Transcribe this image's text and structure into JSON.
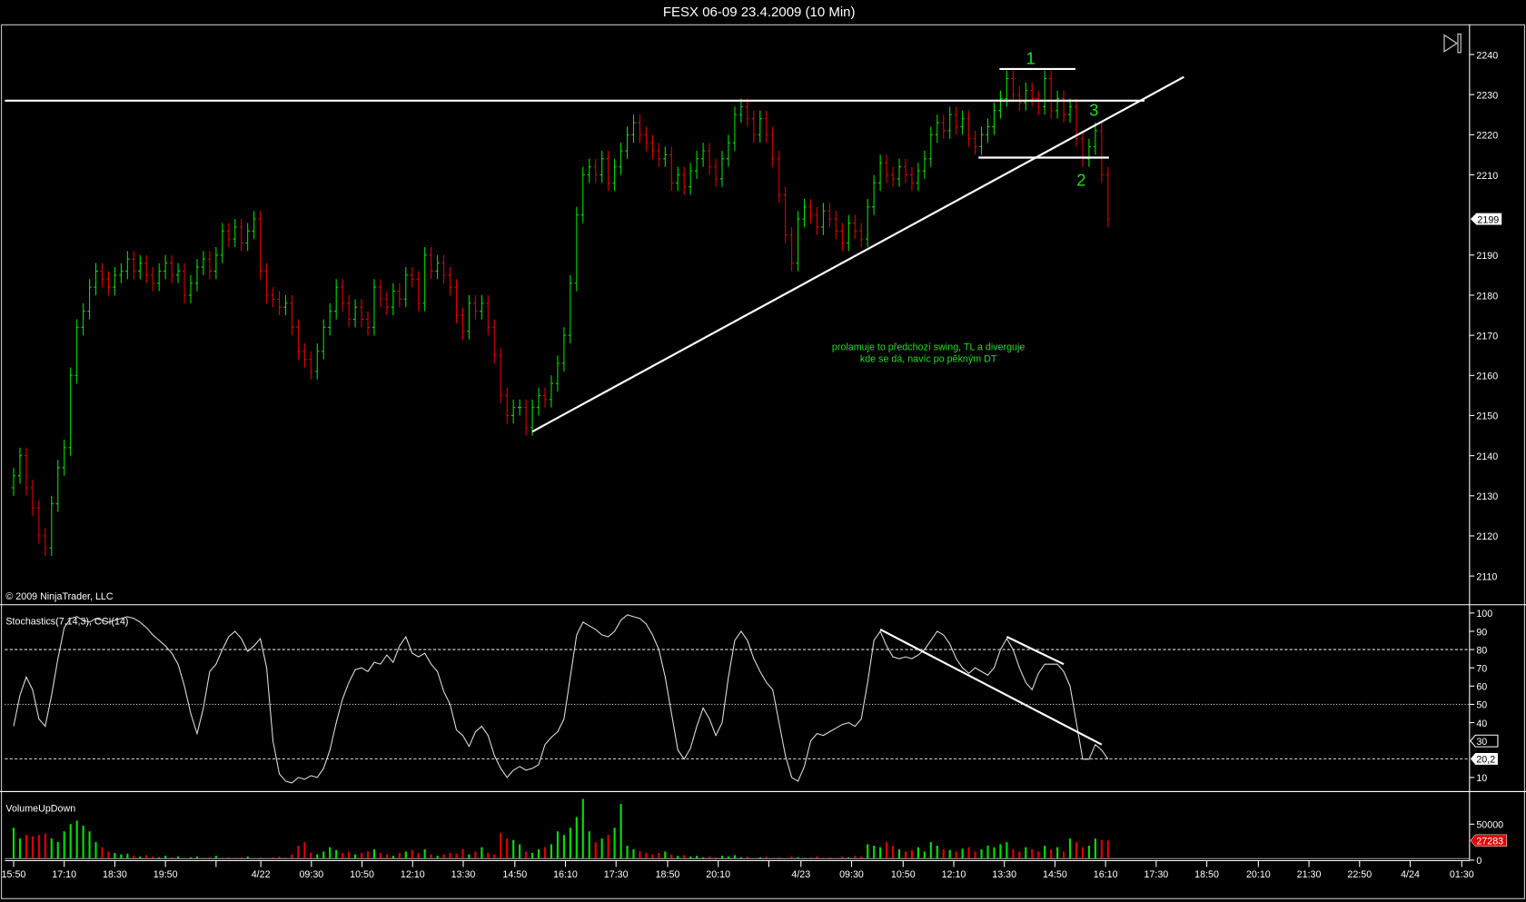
{
  "window": {
    "title": "FESX 06-09  23.4.2009 (10 Min)"
  },
  "copyright": "© 2009 NinjaTrader, LLC",
  "play_button_icon": "skip-to-end-icon",
  "colors": {
    "up": "#00e000",
    "down": "#e00000",
    "line": "#ffffff",
    "annotation": "#22dd22",
    "last_volume_tag": "#e00000"
  },
  "chart_data": [
    {
      "type": "candlestick",
      "title": "FESX 06-09  23.4.2009 (10 Min)",
      "ylim": [
        2106,
        2246
      ],
      "yticks": [
        "2240",
        "2230",
        "2220",
        "2210",
        "2190",
        "2180",
        "2170",
        "2160",
        "2150",
        "2140",
        "2130",
        "2120",
        "2110"
      ],
      "ytick_values": [
        2240,
        2230,
        2220,
        2210,
        2190,
        2180,
        2170,
        2160,
        2150,
        2140,
        2130,
        2120,
        2110
      ],
      "last_price_label": "2199",
      "last_price": 2199,
      "bar_interval": "10 Min",
      "close": [
        2135,
        2140,
        2132,
        2127,
        2120,
        2117,
        2128,
        2137,
        2142,
        2160,
        2172,
        2176,
        2182,
        2186,
        2184,
        2182,
        2185,
        2186,
        2189,
        2186,
        2188,
        2185,
        2183,
        2186,
        2188,
        2185,
        2186,
        2180,
        2183,
        2187,
        2189,
        2186,
        2190,
        2196,
        2194,
        2197,
        2193,
        2196,
        2199,
        2186,
        2180,
        2179,
        2177,
        2178,
        2172,
        2166,
        2164,
        2161,
        2166,
        2172,
        2176,
        2182,
        2178,
        2174,
        2177,
        2174,
        2172,
        2182,
        2179,
        2177,
        2181,
        2179,
        2185,
        2184,
        2178,
        2190,
        2186,
        2188,
        2185,
        2182,
        2175,
        2171,
        2178,
        2176,
        2178,
        2172,
        2165,
        2155,
        2150,
        2152,
        2152,
        2147,
        2152,
        2155,
        2154,
        2158,
        2163,
        2170,
        2183,
        2200,
        2210,
        2212,
        2210,
        2214,
        2208,
        2212,
        2216,
        2220,
        2223,
        2220,
        2218,
        2216,
        2214,
        2215,
        2208,
        2210,
        2207,
        2211,
        2214,
        2216,
        2212,
        2209,
        2214,
        2218,
        2225,
        2227,
        2224,
        2220,
        2224,
        2220,
        2214,
        2205,
        2195,
        2188,
        2199,
        2202,
        2200,
        2197,
        2201,
        2199,
        2196,
        2193,
        2198,
        2196,
        2194,
        2202,
        2208,
        2213,
        2210,
        2209,
        2212,
        2210,
        2208,
        2211,
        2214,
        2220,
        2223,
        2221,
        2225,
        2222,
        2224,
        2219,
        2217,
        2220,
        2222,
        2226,
        2229,
        2234,
        2230,
        2228,
        2231,
        2229,
        2227,
        2234,
        2226,
        2229,
        2225,
        2227,
        2219,
        2214,
        2217,
        2221,
        2210,
        2199
      ],
      "drawings": {
        "resistance_line": {
          "price": 2228.5,
          "label": "horizontal line"
        },
        "trend_line": {
          "from_bar": 82,
          "from_price": 2146,
          "to_bar": 185,
          "to_price": 2234.4
        },
        "top_range": {
          "price": 2236.4,
          "from_bar": 156,
          "to_bar": 168
        },
        "bottom_range": {
          "price": 2214.3,
          "from_bar": 153,
          "to_bar": 171
        }
      },
      "annotations": {
        "label_1": "1",
        "label_2": "2",
        "label_3": "3",
        "note_line1": "prolamuje to předchozí swing, TL a diverguje",
        "note_line2": "kde se dá, navíc po pěkným DT"
      }
    },
    {
      "type": "line",
      "title": "Stochastics(7,14,3), CCI(14)",
      "ylim": [
        0,
        105
      ],
      "yticks": [
        "100",
        "90",
        "80",
        "70",
        "60",
        "50",
        "40",
        "10"
      ],
      "ytick_values": [
        100,
        90,
        80,
        70,
        60,
        50,
        40,
        10
      ],
      "reference_lines": [
        80,
        50,
        20.2
      ],
      "marker_30": "30",
      "last_value_label": "20,2",
      "values": [
        38,
        55,
        65,
        58,
        42,
        38,
        55,
        75,
        92,
        97,
        98,
        96,
        95,
        97,
        96,
        95,
        96,
        97,
        98,
        97,
        95,
        92,
        88,
        85,
        82,
        78,
        72,
        60,
        45,
        34,
        48,
        68,
        72,
        80,
        87,
        90,
        86,
        79,
        82,
        86,
        70,
        30,
        12,
        8,
        7,
        10,
        9,
        11,
        10,
        15,
        25,
        40,
        53,
        62,
        69,
        70,
        68,
        73,
        72,
        77,
        73,
        82,
        87,
        78,
        76,
        78,
        72,
        68,
        57,
        50,
        36,
        33,
        27,
        35,
        38,
        33,
        22,
        15,
        10,
        14,
        16,
        14,
        15,
        17,
        28,
        32,
        35,
        42,
        65,
        88,
        95,
        93,
        91,
        88,
        87,
        90,
        96,
        99,
        98,
        97,
        94,
        88,
        80,
        65,
        45,
        25,
        20,
        26,
        38,
        48,
        42,
        33,
        40,
        65,
        85,
        90,
        85,
        75,
        68,
        62,
        58,
        40,
        22,
        10,
        8,
        16,
        30,
        34,
        33,
        35,
        37,
        39,
        40,
        38,
        42,
        62,
        85,
        90,
        82,
        76,
        75,
        76,
        75,
        77,
        80,
        85,
        90,
        88,
        83,
        75,
        70,
        67,
        70,
        68,
        66,
        70,
        80,
        86,
        80,
        70,
        62,
        58,
        67,
        72,
        72,
        72,
        68,
        60,
        40,
        20,
        20,
        28,
        25,
        20
      ],
      "divergence_lines": [
        {
          "from_bar": 137,
          "from_value": 91,
          "to_bar": 172,
          "to_value": 28
        },
        {
          "from_bar": 157,
          "from_value": 87,
          "to_bar": 166,
          "to_value": 72
        }
      ]
    },
    {
      "type": "bar",
      "title": "VolumeUpDown",
      "ylim": [
        0,
        95000
      ],
      "yticks": [
        "50000",
        "0"
      ],
      "ytick_values": [
        50000,
        0
      ],
      "last_value_label": "27283",
      "values": [
        45000,
        30000,
        35000,
        33000,
        35000,
        37000,
        30000,
        25000,
        40000,
        50000,
        55000,
        48000,
        40000,
        25000,
        18000,
        12000,
        10000,
        8000,
        9000,
        6000,
        5000,
        7000,
        5000,
        4000,
        6000,
        4000,
        5000,
        3000,
        4000,
        5000,
        3000,
        4000,
        6000,
        3000,
        4000,
        3000,
        4000,
        5000,
        3000,
        4000,
        3000,
        4000,
        5000,
        3000,
        8000,
        20000,
        25000,
        10000,
        8000,
        12000,
        18000,
        14000,
        10000,
        12000,
        8000,
        10000,
        12000,
        15000,
        10000,
        8000,
        6000,
        10000,
        12000,
        14000,
        10000,
        15000,
        8000,
        6000,
        8000,
        10000,
        9000,
        15000,
        8000,
        12000,
        18000,
        10000,
        8000,
        38000,
        30000,
        28000,
        22000,
        12000,
        10000,
        15000,
        18000,
        22000,
        40000,
        35000,
        45000,
        60000,
        85000,
        40000,
        25000,
        30000,
        35000,
        45000,
        78000,
        20000,
        15000,
        12000,
        10000,
        8000,
        10000,
        12000,
        8000,
        6000,
        7000,
        5000,
        6000,
        4000,
        5000,
        4000,
        6000,
        5000,
        7000,
        4000,
        5000,
        3000,
        4000,
        5000,
        3000,
        4000,
        3000,
        5000,
        4000,
        3000,
        4000,
        5000,
        3000,
        4000,
        3000,
        5000,
        4000,
        6000,
        5000,
        22000,
        20000,
        18000,
        25000,
        20000,
        15000,
        12000,
        14000,
        18000,
        12000,
        25000,
        20000,
        15000,
        14000,
        12000,
        16000,
        18000,
        12000,
        15000,
        20000,
        18000,
        22000,
        25000,
        15000,
        12000,
        18000,
        15000,
        12000,
        20000,
        15000,
        18000,
        12000,
        30000,
        25000,
        18000,
        20000,
        30000,
        28000,
        27283
      ]
    }
  ],
  "x_axis": {
    "labels": [
      "15:50",
      "17:10",
      "18:30",
      "19:50",
      "4/22",
      "09:30",
      "10:50",
      "12:10",
      "13:30",
      "14:50",
      "16:10",
      "17:30",
      "18:50",
      "20:10",
      "4/23",
      "09:30",
      "10:50",
      "12:10",
      "13:30",
      "14:50",
      "16:10",
      "17:30",
      "18:50",
      "20:10",
      "21:30",
      "22:50",
      "4/24",
      "01:30"
    ]
  }
}
